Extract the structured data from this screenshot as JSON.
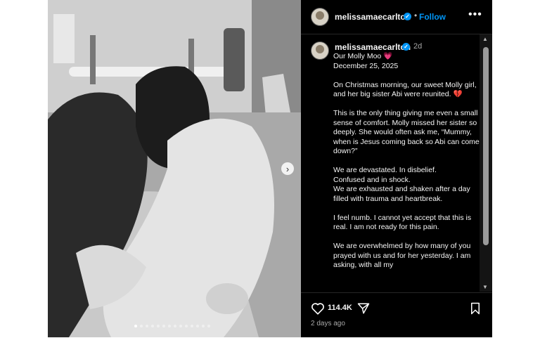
{
  "post": {
    "username": "melissamaecarlton",
    "separator": "•",
    "follow_label": "Follow",
    "more_icon": "more-horizontal-icon",
    "caption_time": "2d",
    "caption": {
      "line1": "Our Molly Moo",
      "line2": "December 25, 2025",
      "p2": "On Christmas morning, our sweet Molly girl, and her big sister Abi were reunited.",
      "p3": "This is the only thing giving me even a small sense of comfort. Molly missed her sister so deeply. She would often ask me, “Mummy, when is Jesus coming back so Abi can come down?”",
      "p4a": "We are devastated. In disbelief.",
      "p4b": "Confused and in shock.",
      "p4c": "We are exhausted and shaken after a day filled with trauma and heartbreak.",
      "p5": "I feel numb. I cannot yet accept that this is real. I am not ready for this pain.",
      "p6": "We are overwhelmed by how many of you prayed with us and for her yesterday. I am asking, with all my"
    },
    "emoji": {
      "pink_heart": "💗",
      "broken_heart": "💔"
    },
    "likes": "114.4K",
    "time_ago": "2 days ago",
    "next_arrow": "›",
    "verified_mark": "✓",
    "more_dots": "•••",
    "carousel": {
      "count": 14,
      "active_index": 0
    },
    "colors": {
      "accent": "#0095f6",
      "panel_bg": "#000000",
      "heart": "#e0245e"
    }
  }
}
